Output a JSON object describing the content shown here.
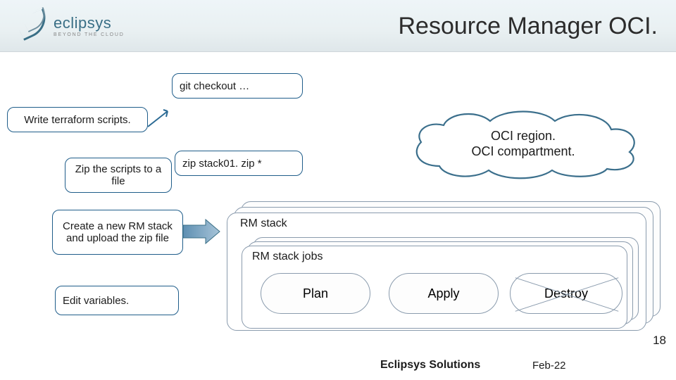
{
  "brand": {
    "name": "eclipsys",
    "tagline": "BEYOND THE CLOUD"
  },
  "title": "Resource Manager OCI.",
  "steps": {
    "write": "Write terraform scripts.",
    "git": "git checkout …",
    "zip": "Zip the scripts to a file",
    "zipcmd": "zip stack01. zip *",
    "create": "Create a new RM stack and upload the zip file",
    "edit": "Edit variables."
  },
  "cloud": {
    "line1": "OCI region.",
    "line2": "OCI compartment."
  },
  "rm": {
    "stack_label": "RM stack",
    "jobs_label": "RM stack jobs",
    "jobs": {
      "plan": "Plan",
      "apply": "Apply",
      "destroy": "Destroy"
    }
  },
  "pagenum": "18",
  "footer": {
    "company": "Eclipsys Solutions",
    "date": "Feb-22"
  }
}
